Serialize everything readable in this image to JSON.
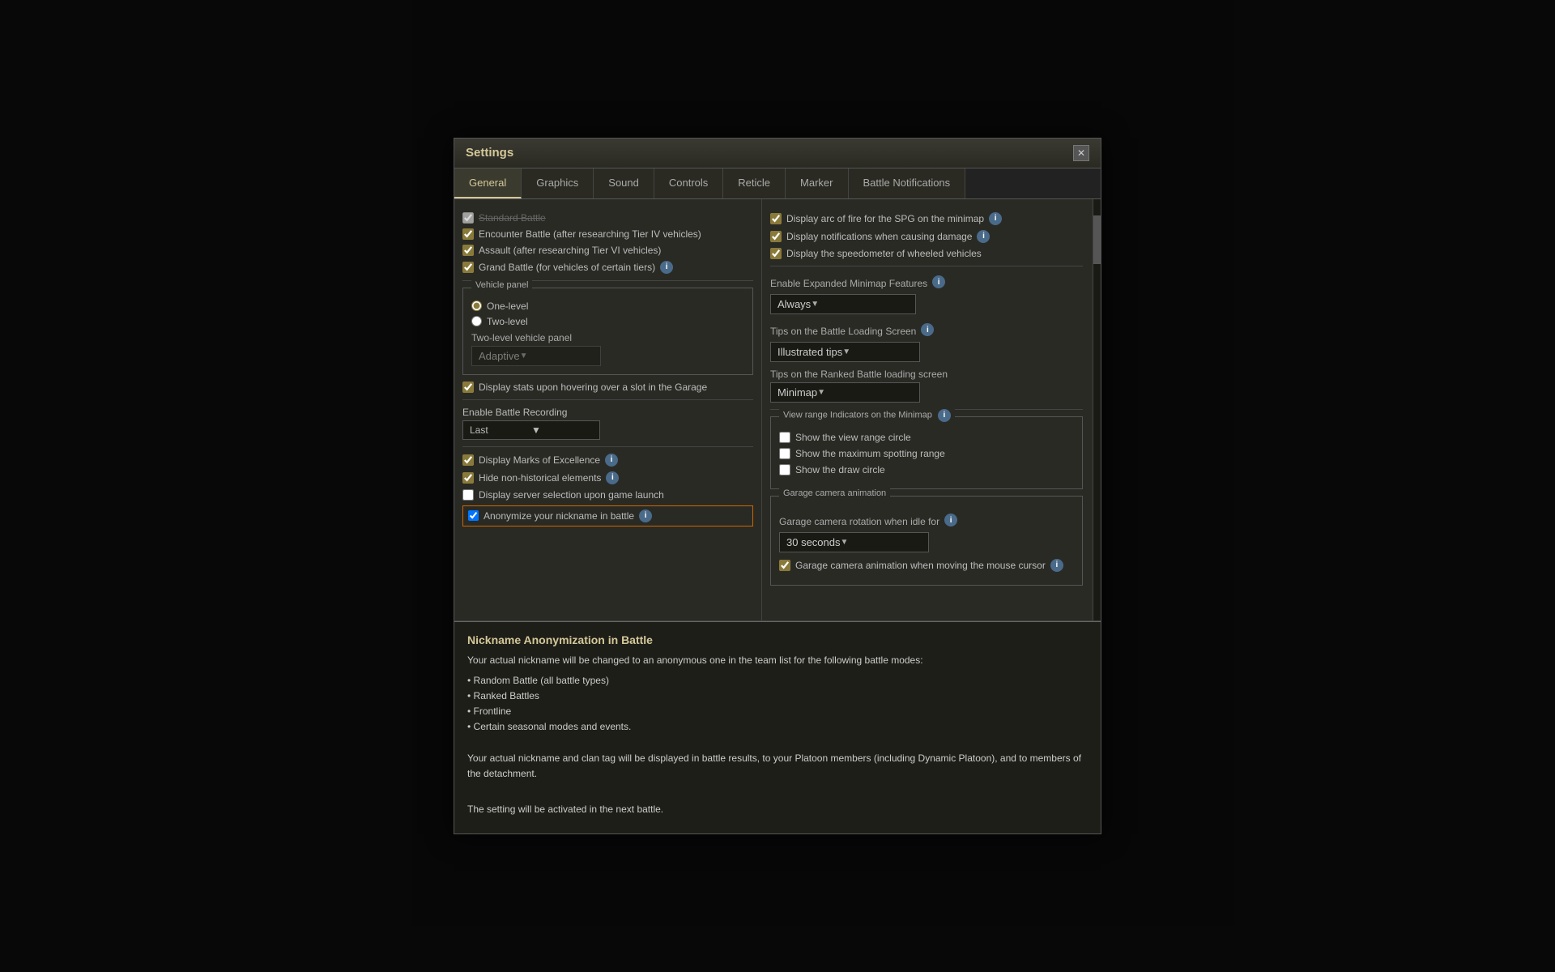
{
  "window": {
    "title": "Settings",
    "close_label": "✕"
  },
  "tabs": [
    {
      "id": "general",
      "label": "General",
      "active": true
    },
    {
      "id": "graphics",
      "label": "Graphics",
      "active": false
    },
    {
      "id": "sound",
      "label": "Sound",
      "active": false
    },
    {
      "id": "controls",
      "label": "Controls",
      "active": false
    },
    {
      "id": "reticle",
      "label": "Reticle",
      "active": false
    },
    {
      "id": "marker",
      "label": "Marker",
      "active": false
    },
    {
      "id": "battle_notifications",
      "label": "Battle Notifications",
      "active": false
    }
  ],
  "left_panel": {
    "battle_modes": {
      "standard_battle": {
        "label": "Standard Battle",
        "checked": true,
        "faded": true
      },
      "encounter": {
        "label": "Encounter Battle (after researching Tier IV vehicles)",
        "checked": true
      },
      "assault": {
        "label": "Assault (after researching Tier VI vehicles)",
        "checked": true
      },
      "grand_battle": {
        "label": "Grand Battle (for vehicles of certain tiers)",
        "checked": true,
        "has_info": true
      }
    },
    "vehicle_panel": {
      "label": "Vehicle panel",
      "one_level": {
        "label": "One-level",
        "selected": true
      },
      "two_level": {
        "label": "Two-level",
        "selected": false
      },
      "two_level_panel_label": "Two-level vehicle panel",
      "adaptive_option": "Adaptive",
      "adaptive_disabled": true
    },
    "display_stats": {
      "label": "Display stats upon hovering over a slot in the Garage",
      "checked": true
    },
    "battle_recording": {
      "label": "Enable Battle Recording",
      "option": "Last"
    },
    "display_marks": {
      "label": "Display Marks of Excellence",
      "checked": true,
      "has_info": true
    },
    "hide_non_historical": {
      "label": "Hide non-historical elements",
      "checked": true,
      "has_info": true
    },
    "display_server_selection": {
      "label": "Display server selection upon game launch",
      "checked": false
    },
    "anonymize_nickname": {
      "label": "Anonymize your nickname in battle",
      "checked": true,
      "has_info": true,
      "highlighted": true
    }
  },
  "right_panel": {
    "checkboxes": [
      {
        "label": "Display arc of fire for the SPG on the minimap",
        "checked": true,
        "has_info": true
      },
      {
        "label": "Display notifications when causing damage",
        "checked": true,
        "has_info": true
      },
      {
        "label": "Display the speedometer of wheeled vehicles",
        "checked": true
      }
    ],
    "expanded_minimap": {
      "label": "Enable Expanded Minimap Features",
      "has_info": true,
      "option": "Always"
    },
    "tips_battle_loading": {
      "label": "Tips on the Battle Loading Screen",
      "has_info": true,
      "option": "Illustrated tips"
    },
    "tips_ranked_loading": {
      "label": "Tips on the Ranked Battle loading screen",
      "option": "Minimap"
    },
    "view_range_indicators": {
      "group_label": "View range Indicators on the Minimap",
      "has_info": true,
      "show_view_range": {
        "label": "Show the view range circle",
        "checked": false
      },
      "show_max_spotting": {
        "label": "Show the maximum spotting range",
        "checked": false
      },
      "show_draw_circle": {
        "label": "Show the draw circle",
        "checked": false
      }
    },
    "garage_camera": {
      "group_label": "Garage camera animation",
      "rotation_label": "Garage camera rotation when idle for",
      "has_info": true,
      "rotation_option": "30 seconds",
      "animation_checkbox": {
        "label": "Garage camera animation when moving the mouse cursor",
        "checked": true,
        "has_info": true
      }
    }
  },
  "tooltip": {
    "title": "Nickname Anonymization in Battle",
    "description": "Your actual nickname will be changed to an anonymous one in the team list for the following battle modes:",
    "bullet_points": [
      "Random Battle (all battle types)",
      "Ranked Battles",
      "Frontline",
      "Certain seasonal modes and events."
    ],
    "extra_text": "Your actual nickname and clan tag will be displayed in battle results, to your Platoon members (including Dynamic Platoon), and to members of the detachment.",
    "activation_note": "The setting will be activated in the next battle."
  }
}
